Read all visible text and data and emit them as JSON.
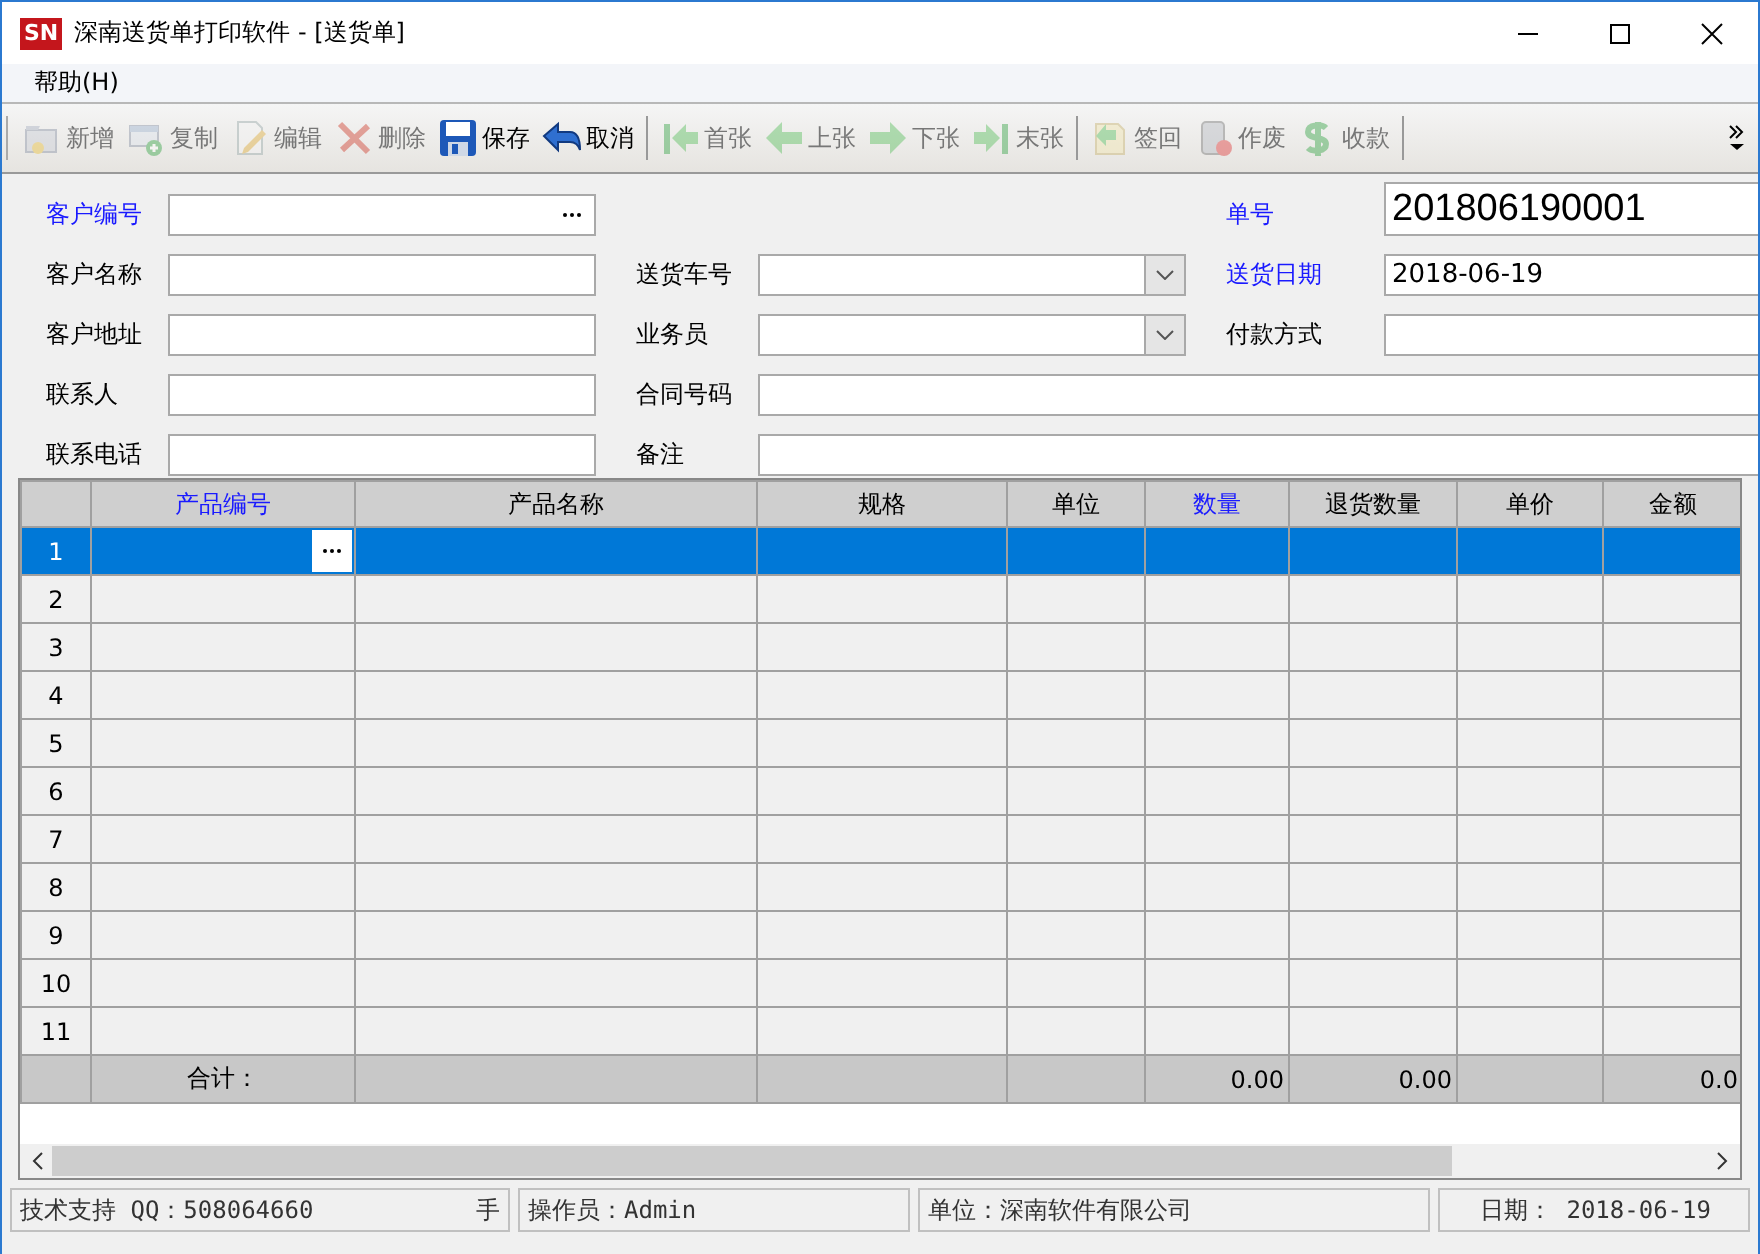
{
  "window": {
    "logo": "SN",
    "title": "深南送货单打印软件 - [送货单]"
  },
  "menu": [
    "帮助(H)"
  ],
  "toolbar": [
    {
      "kind": "button",
      "label": "新增",
      "disabled": true
    },
    {
      "kind": "button",
      "label": "复制",
      "disabled": true
    },
    {
      "kind": "button",
      "label": "编辑",
      "disabled": true
    },
    {
      "kind": "button",
      "label": "删除",
      "disabled": true
    },
    {
      "kind": "button",
      "label": "保存",
      "disabled": false
    },
    {
      "kind": "button",
      "label": "取消",
      "disabled": false
    },
    {
      "kind": "separator"
    },
    {
      "kind": "button",
      "label": "首张",
      "disabled": true
    },
    {
      "kind": "button",
      "label": "上张",
      "disabled": true
    },
    {
      "kind": "button",
      "label": "下张",
      "disabled": true
    },
    {
      "kind": "button",
      "label": "末张",
      "disabled": true
    },
    {
      "kind": "separator"
    },
    {
      "kind": "button",
      "label": "签回",
      "disabled": true
    },
    {
      "kind": "button",
      "label": "作废",
      "disabled": true
    },
    {
      "kind": "button",
      "label": "收款",
      "disabled": true
    },
    {
      "kind": "separator"
    }
  ],
  "form": {
    "left": [
      {
        "label": "客户编号",
        "required": true,
        "kind": "lookup"
      },
      {
        "label": "客户名称",
        "required": false,
        "kind": "text"
      },
      {
        "label": "客户地址",
        "required": false,
        "kind": "text"
      },
      {
        "label": "联系人",
        "required": false,
        "kind": "text"
      },
      {
        "label": "联系电话",
        "required": false,
        "kind": "text"
      }
    ],
    "middle": [
      {
        "label": "送货车号",
        "required": false,
        "kind": "combo"
      },
      {
        "label": "业务员",
        "required": false,
        "kind": "combo"
      },
      {
        "label": "合同号码",
        "required": false,
        "kind": "text"
      },
      {
        "label": "备注",
        "required": false,
        "kind": "text"
      }
    ],
    "right": [
      {
        "label": "单号",
        "required": true,
        "kind": "large",
        "value": "201806190001"
      },
      {
        "label": "送货日期",
        "required": true,
        "kind": "text",
        "value": "2018-06-19"
      },
      {
        "label": "付款方式",
        "required": false,
        "kind": "text"
      }
    ]
  },
  "table": {
    "columns": [
      {
        "label": "产品编号",
        "required": true
      },
      {
        "label": "产品名称",
        "required": false
      },
      {
        "label": "规格",
        "required": false
      },
      {
        "label": "单位",
        "required": false
      },
      {
        "label": "数量",
        "required": true,
        "total": "0.00"
      },
      {
        "label": "退货数量",
        "required": false,
        "total": "0.00"
      },
      {
        "label": "单价",
        "required": false
      },
      {
        "label": "金额",
        "required": false,
        "total": "0.0"
      }
    ],
    "rows": [
      {
        "number": "1",
        "selected": true
      },
      {
        "number": "2",
        "selected": false
      },
      {
        "number": "3",
        "selected": false
      },
      {
        "number": "4",
        "selected": false
      },
      {
        "number": "5",
        "selected": false
      },
      {
        "number": "6",
        "selected": false
      },
      {
        "number": "7",
        "selected": false
      },
      {
        "number": "8",
        "selected": false
      },
      {
        "number": "9",
        "selected": false
      },
      {
        "number": "10",
        "selected": false
      },
      {
        "number": "11",
        "selected": false
      }
    ],
    "totals_label": "合计："
  },
  "status_bar": [
    "技术支持 QQ：508064660",
    "手",
    "操作员：Admin",
    "单位：深南软件有限公司",
    "日期：  2018-06-19"
  ]
}
